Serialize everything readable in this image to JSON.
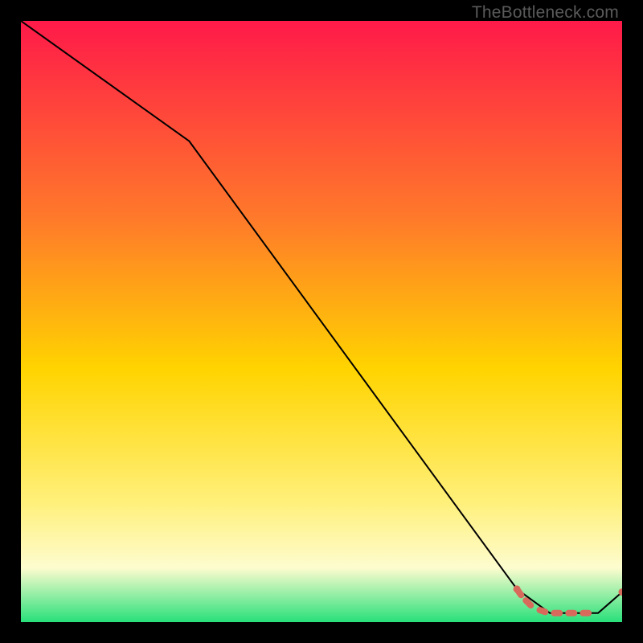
{
  "watermark": "TheBottleneck.com",
  "colors": {
    "black": "#000000",
    "grad_top": "#ff1a49",
    "grad_mid_upper": "#ff7a2a",
    "grad_mid": "#ffd400",
    "grad_mid_lower": "#fff07a",
    "grad_pale": "#fdfccf",
    "grad_green": "#28e07a",
    "line": "#000000",
    "marker": "#d86a5c"
  },
  "chart_data": {
    "type": "line",
    "title": "",
    "xlabel": "",
    "ylabel": "",
    "xlim": [
      0,
      100
    ],
    "ylim": [
      0,
      100
    ],
    "series": [
      {
        "name": "curve",
        "x": [
          0,
          28,
          82.5,
          88,
          96,
          100
        ],
        "y": [
          100,
          80,
          5.5,
          1.5,
          1.5,
          5
        ]
      }
    ],
    "markers": {
      "name": "dashed-cluster",
      "points": [
        {
          "x": 82.5,
          "y": 5.5
        },
        {
          "x": 83.2,
          "y": 4.5
        },
        {
          "x": 84.0,
          "y": 3.6
        },
        {
          "x": 84.8,
          "y": 2.8
        },
        {
          "x": 86.3,
          "y": 2.0
        },
        {
          "x": 87.2,
          "y": 1.7
        },
        {
          "x": 88.7,
          "y": 1.5
        },
        {
          "x": 89.6,
          "y": 1.5
        },
        {
          "x": 91.1,
          "y": 1.5
        },
        {
          "x": 92.0,
          "y": 1.5
        },
        {
          "x": 93.5,
          "y": 1.5
        },
        {
          "x": 94.4,
          "y": 1.5
        },
        {
          "x": 95.9,
          "y": 1.5
        },
        {
          "x": 100.0,
          "y": 5.0
        }
      ]
    }
  }
}
